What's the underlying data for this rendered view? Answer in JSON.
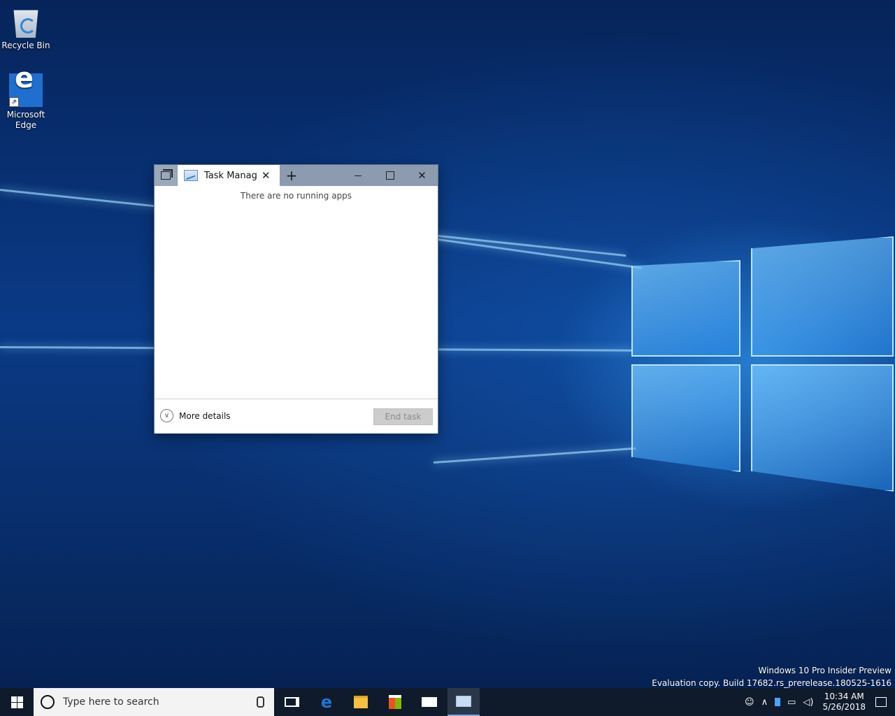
{
  "desktop": {
    "icons": [
      {
        "label": "Recycle Bin",
        "icon": "recycle-bin-icon"
      },
      {
        "label": "Microsoft\nEdge",
        "icon": "edge-icon"
      }
    ]
  },
  "window": {
    "tab_title": "Task Manager",
    "empty_message": "There are no running apps",
    "more_details": "More details",
    "end_task": "End task",
    "new_tab_glyph": "+",
    "close_glyph": "✕",
    "minimize_glyph": "—"
  },
  "watermark": {
    "line1": "Windows 10 Pro Insider Preview",
    "line2": "Evaluation copy. Build 17682.rs_prerelease.180525-1616"
  },
  "taskbar": {
    "search_placeholder": "Type here to search",
    "time": "10:34 AM",
    "date": "5/26/2018"
  }
}
